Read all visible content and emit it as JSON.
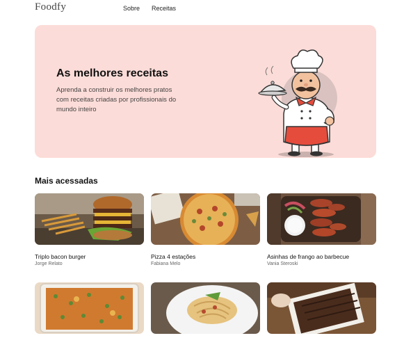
{
  "header": {
    "logo": "Foodfy",
    "nav": [
      {
        "label": "Sobre"
      },
      {
        "label": "Receitas"
      }
    ]
  },
  "hero": {
    "title": "As melhores receitas",
    "subtitle": "Aprenda a construir os melhores pratos com receitas criadas por profissionais do mundo inteiro"
  },
  "section": {
    "title": "Mais acessadas"
  },
  "recipes": [
    {
      "name": "Triplo bacon burger",
      "author": "Jorge Relato"
    },
    {
      "name": "Pizza 4 estações",
      "author": "Fabiana Melo"
    },
    {
      "name": "Asinhas de frango ao barbecue",
      "author": "Vania Steroski"
    },
    {
      "name": "",
      "author": ""
    },
    {
      "name": "",
      "author": ""
    },
    {
      "name": "",
      "author": ""
    }
  ],
  "colors": {
    "hero_bg": "#fcdcd8",
    "accent": "#e54c3c"
  }
}
